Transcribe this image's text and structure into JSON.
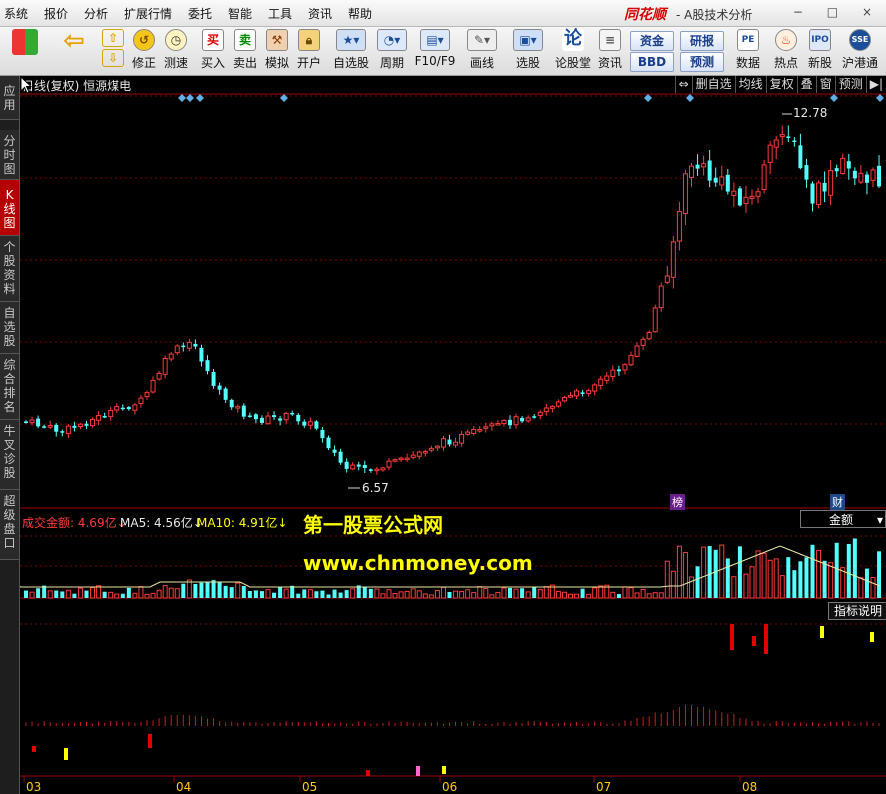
{
  "menubar": {
    "items": [
      "系统",
      "报价",
      "分析",
      "扩展行情",
      "委托",
      "智能",
      "工具",
      "资讯",
      "帮助"
    ],
    "brand": "同花顺",
    "app_title": "- A股技术分析",
    "window_controls": "− □ ×"
  },
  "toolbar": {
    "buttons": [
      "修正",
      "测速",
      "买入",
      "卖出",
      "模拟",
      "开户",
      "自选股",
      "周期",
      "F10/F9",
      "画线",
      "选股",
      "论股堂",
      "资讯",
      "数据",
      "热点",
      "新股",
      "沪港通"
    ],
    "pills": [
      "资金",
      "研报",
      "BBD",
      "预测"
    ]
  },
  "side_tabs": [
    "应用",
    "分时图",
    "K线图",
    "个股资料",
    "自选股",
    "综合排名",
    "牛叉诊股",
    "超级盘口"
  ],
  "chart": {
    "header": "日线(复权) 恒源煤电",
    "right_tools": [
      "⇔",
      "删自选",
      "均线",
      "复权",
      "叠",
      "窗",
      "预测",
      "▶|"
    ],
    "price_high_label": "12.78",
    "price_low_label": "6.57",
    "tag_bang": "榜",
    "tag_cai": "财",
    "volume_header": {
      "turnover": "成交金额: 4.69亿↓",
      "ma5": "MA5: 4.56亿↓",
      "ma10": "MA10: 4.91亿↓"
    },
    "amount_selector": "金额",
    "indicator_button": "指标说明",
    "watermark_title": "第一股票公式网",
    "watermark_url": "www.chnmoney.com",
    "x_axis_labels": [
      "03",
      "04",
      "05",
      "06",
      "07",
      "08"
    ],
    "colors": {
      "up": "#ff3b3b",
      "down": "#54ffff",
      "bg": "#000000",
      "grid": "#7a0000",
      "ma": "#e8e8a0",
      "accent": "#ffff00"
    }
  }
}
